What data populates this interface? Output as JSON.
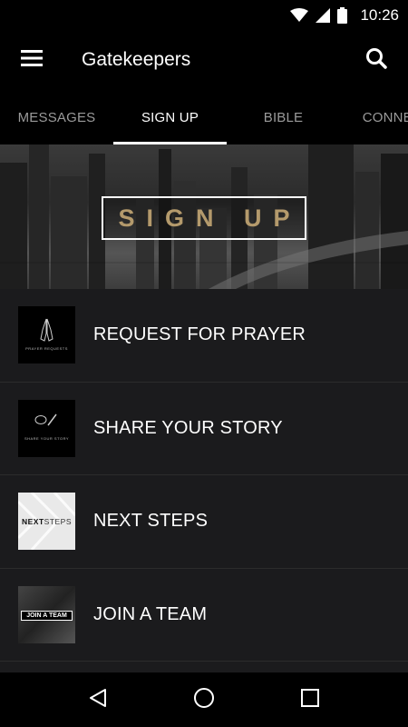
{
  "status_bar": {
    "time": "10:26",
    "icons": [
      "wifi-icon",
      "signal-icon",
      "battery-icon"
    ]
  },
  "app_bar": {
    "title": "Gatekeepers",
    "menu_icon": "hamburger-menu-icon",
    "search_icon": "search-icon"
  },
  "tabs": [
    {
      "label": "MESSAGES",
      "active": false
    },
    {
      "label": "SIGN UP",
      "active": true
    },
    {
      "label": "BIBLE",
      "active": false
    },
    {
      "label": "CONNECT",
      "active": false
    }
  ],
  "banner": {
    "title": "SIGN UP",
    "title_color": "#b49a6c"
  },
  "items": [
    {
      "label": "REQUEST FOR PRAYER",
      "thumb_icon": "praying-hands-icon",
      "thumb_caption": "PRAYER REQUESTS"
    },
    {
      "label": "SHARE YOUR STORY",
      "thumb_icon": "speech-bubble-pen-icon",
      "thumb_caption": "SHARE YOUR STORY"
    },
    {
      "label": "NEXT STEPS",
      "thumb_text_bold": "NEXT",
      "thumb_text": "STEPS"
    },
    {
      "label": "JOIN A TEAM",
      "thumb_text": "JOIN A TEAM"
    }
  ],
  "nav_bar": {
    "icons": [
      "back-icon",
      "home-icon",
      "recents-icon"
    ]
  },
  "colors": {
    "background": "#1b1b1d",
    "bar": "#000000",
    "accent": "#b49a6c"
  }
}
